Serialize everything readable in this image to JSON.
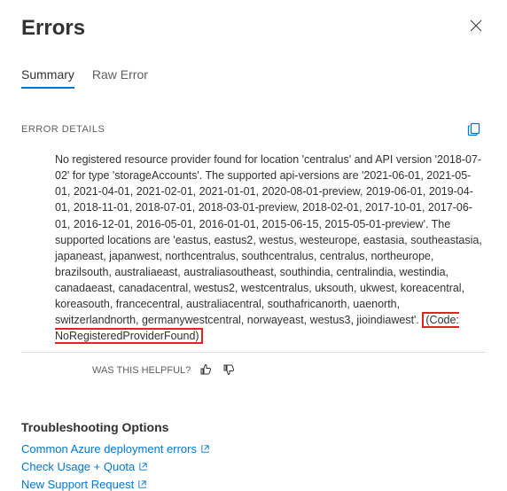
{
  "header": {
    "title": "Errors"
  },
  "tabs": {
    "summary": "Summary",
    "raw": "Raw Error"
  },
  "details": {
    "label": "ERROR DETAILS",
    "message": "No registered resource provider found for location 'centralus' and API version '2018-07-02' for type 'storageAccounts'. The supported api-versions are '2021-06-01, 2021-05-01, 2021-04-01, 2021-02-01, 2021-01-01, 2020-08-01-preview, 2019-06-01, 2019-04-01, 2018-11-01, 2018-07-01, 2018-03-01-preview, 2018-02-01, 2017-10-01, 2017-06-01, 2016-12-01, 2016-05-01, 2016-01-01, 2015-06-15, 2015-05-01-preview'. The supported locations are 'eastus, eastus2, westus, westeurope, eastasia, southeastasia, japaneast, japanwest, northcentralus, southcentralus, centralus, northeurope, brazilsouth, australiaeast, australiasoutheast, southindia, centralindia, westindia, canadaeast, canadacentral, westus2, westcentralus, uksouth, ukwest, koreacentral, koreasouth, francecentral, australiacentral, southafricanorth, uaenorth, switzerlandnorth, germanywestcentral, norwayeast, westus3, jioindiawest'. ",
    "code": "(Code: NoRegisteredProviderFound)"
  },
  "feedback": {
    "label": "WAS THIS HELPFUL?"
  },
  "troubleshoot": {
    "title": "Troubleshooting Options",
    "links": {
      "deployment": "Common Azure deployment errors",
      "quota": "Check Usage + Quota",
      "support": "New Support Request"
    }
  }
}
